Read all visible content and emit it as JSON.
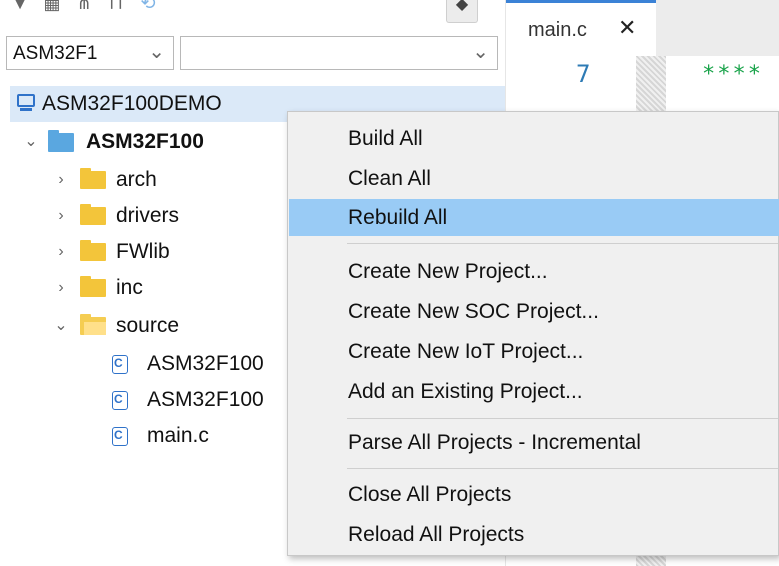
{
  "target_select": {
    "value": "ASM32F1"
  },
  "config_select": {
    "value": ""
  },
  "tree": {
    "root": "ASM32F100DEMO",
    "project": "ASM32F100",
    "folders": [
      "arch",
      "drivers",
      "FWlib",
      "inc",
      "source"
    ],
    "files": [
      "ASM32F100",
      "ASM32F100",
      "main.c"
    ]
  },
  "editor": {
    "tab_title": "main.c",
    "tab_close": "✕",
    "line_number": "7",
    "code": "****"
  },
  "context_menu": {
    "items": [
      "Build All",
      "Clean All",
      "Rebuild All",
      "Create New Project...",
      "Create New SOC Project...",
      "Create New IoT Project...",
      "Add an Existing Project...",
      "Parse All Projects - Incremental",
      "Close All Projects",
      "Reload All Projects"
    ],
    "highlighted": "Rebuild All"
  },
  "colors": {
    "highlight": "#99cbf5",
    "tree_selection": "#dbe9f8",
    "folder": "#f3c53a",
    "project": "#5aa7e0",
    "accent": "#2f72c9",
    "code_comment": "#19a34a"
  }
}
